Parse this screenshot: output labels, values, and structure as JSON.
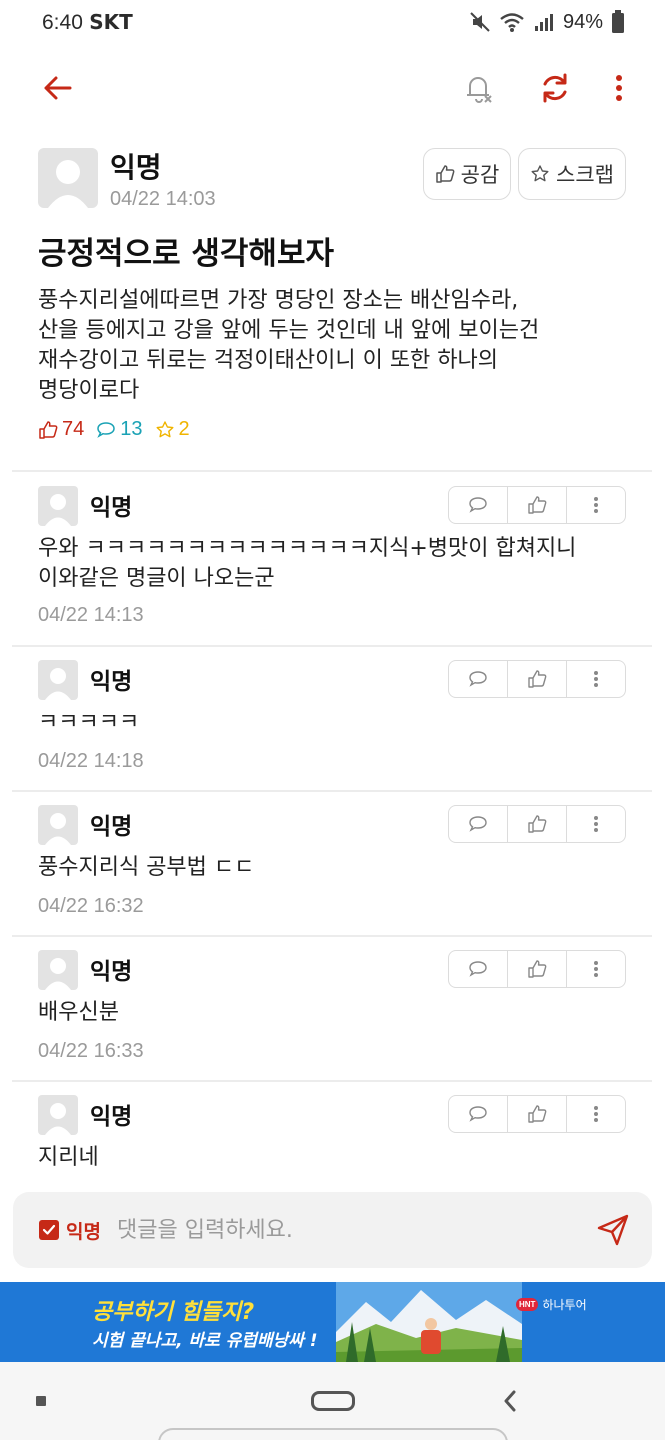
{
  "status": {
    "time": "6:40",
    "carrier": "SKT",
    "battery": "94%"
  },
  "post": {
    "author": "익명",
    "date": "04/22 14:03",
    "like_button": "공감",
    "scrap_button": "스크랩",
    "title": "긍정적으로 생각해보자",
    "body_lines": [
      "풍수지리설에따르면 가장 명당인 장소는 배산임수라,",
      "산을 등에지고 강을 앞에 두는 것인데 내 앞에 보이는건",
      "재수강이고 뒤로는 걱정이태산이니 이 또한 하나의",
      "명당이로다"
    ],
    "stats": {
      "likes": "74",
      "comments": "13",
      "scraps": "2"
    }
  },
  "comments": [
    {
      "author": "익명",
      "text_lines": [
        "우와 ㅋㅋㅋㅋㅋㅋㅋㅋㅋㅋㅋㅋㅋㅋ지식+병맛이 합쳐지니",
        "이와같은 명글이 나오는군"
      ],
      "date": "04/22 14:13"
    },
    {
      "author": "익명",
      "text_lines": [
        "ㅋㅋㅋㅋㅋ"
      ],
      "date": "04/22 14:18"
    },
    {
      "author": "익명",
      "text_lines": [
        "풍수지리식 공부법 ㄷㄷ"
      ],
      "date": "04/22 16:32"
    },
    {
      "author": "익명",
      "text_lines": [
        "배우신분"
      ],
      "date": "04/22 16:33"
    },
    {
      "author": "익명",
      "text_lines": [
        "지리네"
      ],
      "date": ""
    }
  ],
  "input": {
    "anon_label": "익명",
    "placeholder": "댓글을 입력하세요."
  },
  "ad": {
    "line1": "공부하기 힘들지?",
    "line2": "시험 끝나고, 바로 유럽배낭싸 !",
    "brand": "하나투어",
    "brand_badge": "HNT"
  },
  "colors": {
    "accent": "#c62917",
    "comment_stat": "#1aa2b5",
    "scrap_stat": "#f0b400",
    "ad_bg": "#1f78d6"
  }
}
